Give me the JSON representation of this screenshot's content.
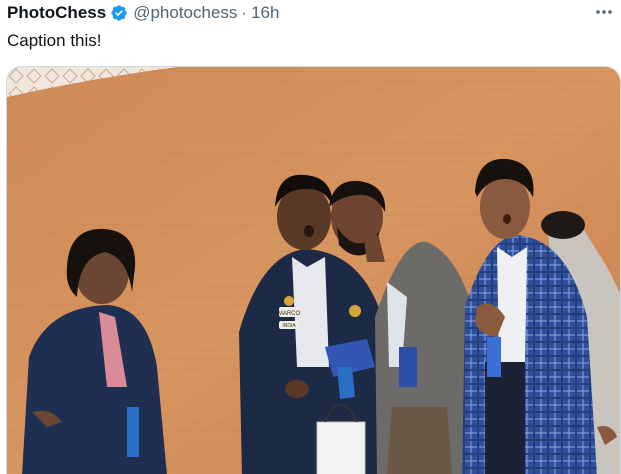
{
  "tweet": {
    "author_name": "PhotoChess",
    "handle": "@photochess",
    "separator": "·",
    "time": "16h",
    "text": "Caption this!",
    "verified_icon": "verified-badge-icon",
    "more_icon": "more-horizontal-icon"
  },
  "photo": {
    "badge_text": "MARCO",
    "name_tag": "INDIA"
  },
  "colors": {
    "handle": "#536471",
    "verified": "#1d9bf0",
    "wall": "#d08a55"
  }
}
